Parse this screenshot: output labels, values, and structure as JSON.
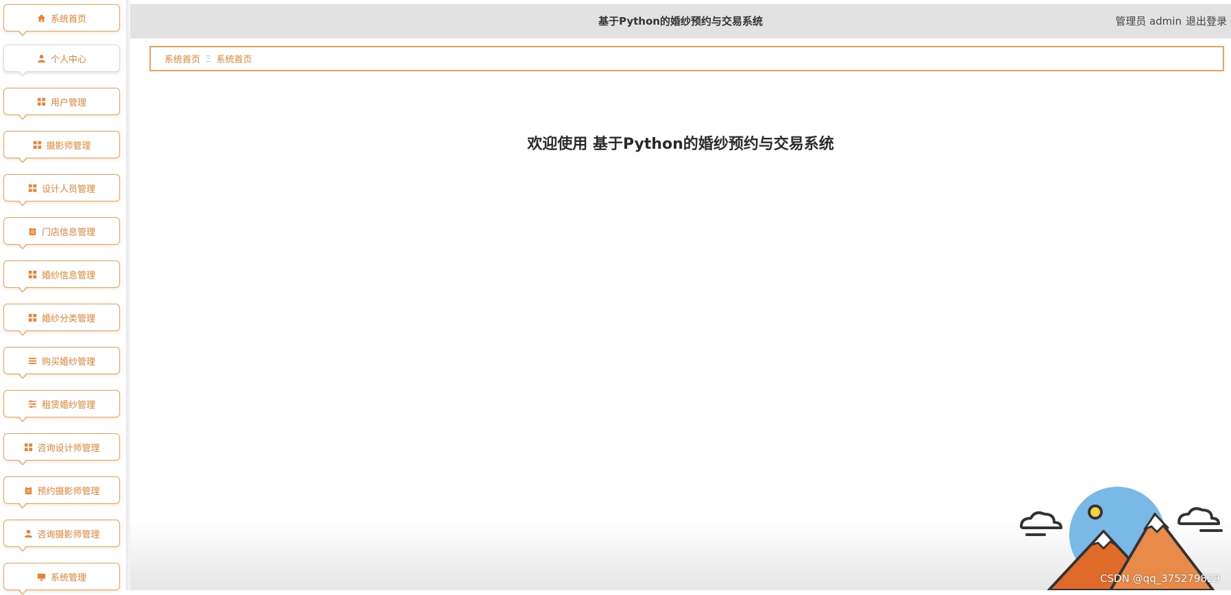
{
  "header": {
    "title": "基于Python的婚纱预约与交易系统",
    "user_label": "管理员 admin",
    "logout_label": "退出登录"
  },
  "sidebar": {
    "items": [
      {
        "label": "系统首页",
        "icon": "home-icon"
      },
      {
        "label": "个人中心",
        "icon": "user-icon"
      },
      {
        "label": "用户管理",
        "icon": "grid-icon"
      },
      {
        "label": "摄影师管理",
        "icon": "grid-icon"
      },
      {
        "label": "设计人员管理",
        "icon": "grid-icon"
      },
      {
        "label": "门店信息管理",
        "icon": "clipboard-icon"
      },
      {
        "label": "婚纱信息管理",
        "icon": "grid-icon"
      },
      {
        "label": "婚纱分类管理",
        "icon": "grid-icon"
      },
      {
        "label": "购买婚纱管理",
        "icon": "list-icon"
      },
      {
        "label": "租赁婚纱管理",
        "icon": "sliders-icon"
      },
      {
        "label": "咨询设计师管理",
        "icon": "grid-icon"
      },
      {
        "label": "预约摄影师管理",
        "icon": "clipboard-icon"
      },
      {
        "label": "咨询摄影师管理",
        "icon": "user-icon"
      },
      {
        "label": "系统管理",
        "icon": "monitor-icon"
      }
    ]
  },
  "breadcrumb": {
    "root": "系统首页",
    "separator": "Ξ",
    "current": "系统首页"
  },
  "main": {
    "welcome": "欢迎使用 基于Python的婚纱预约与交易系统"
  },
  "watermark": "CSDN @qq_375279829",
  "colors": {
    "accent": "#f08030",
    "border": "#f0a05a",
    "header_bg": "#e2e2e2"
  }
}
